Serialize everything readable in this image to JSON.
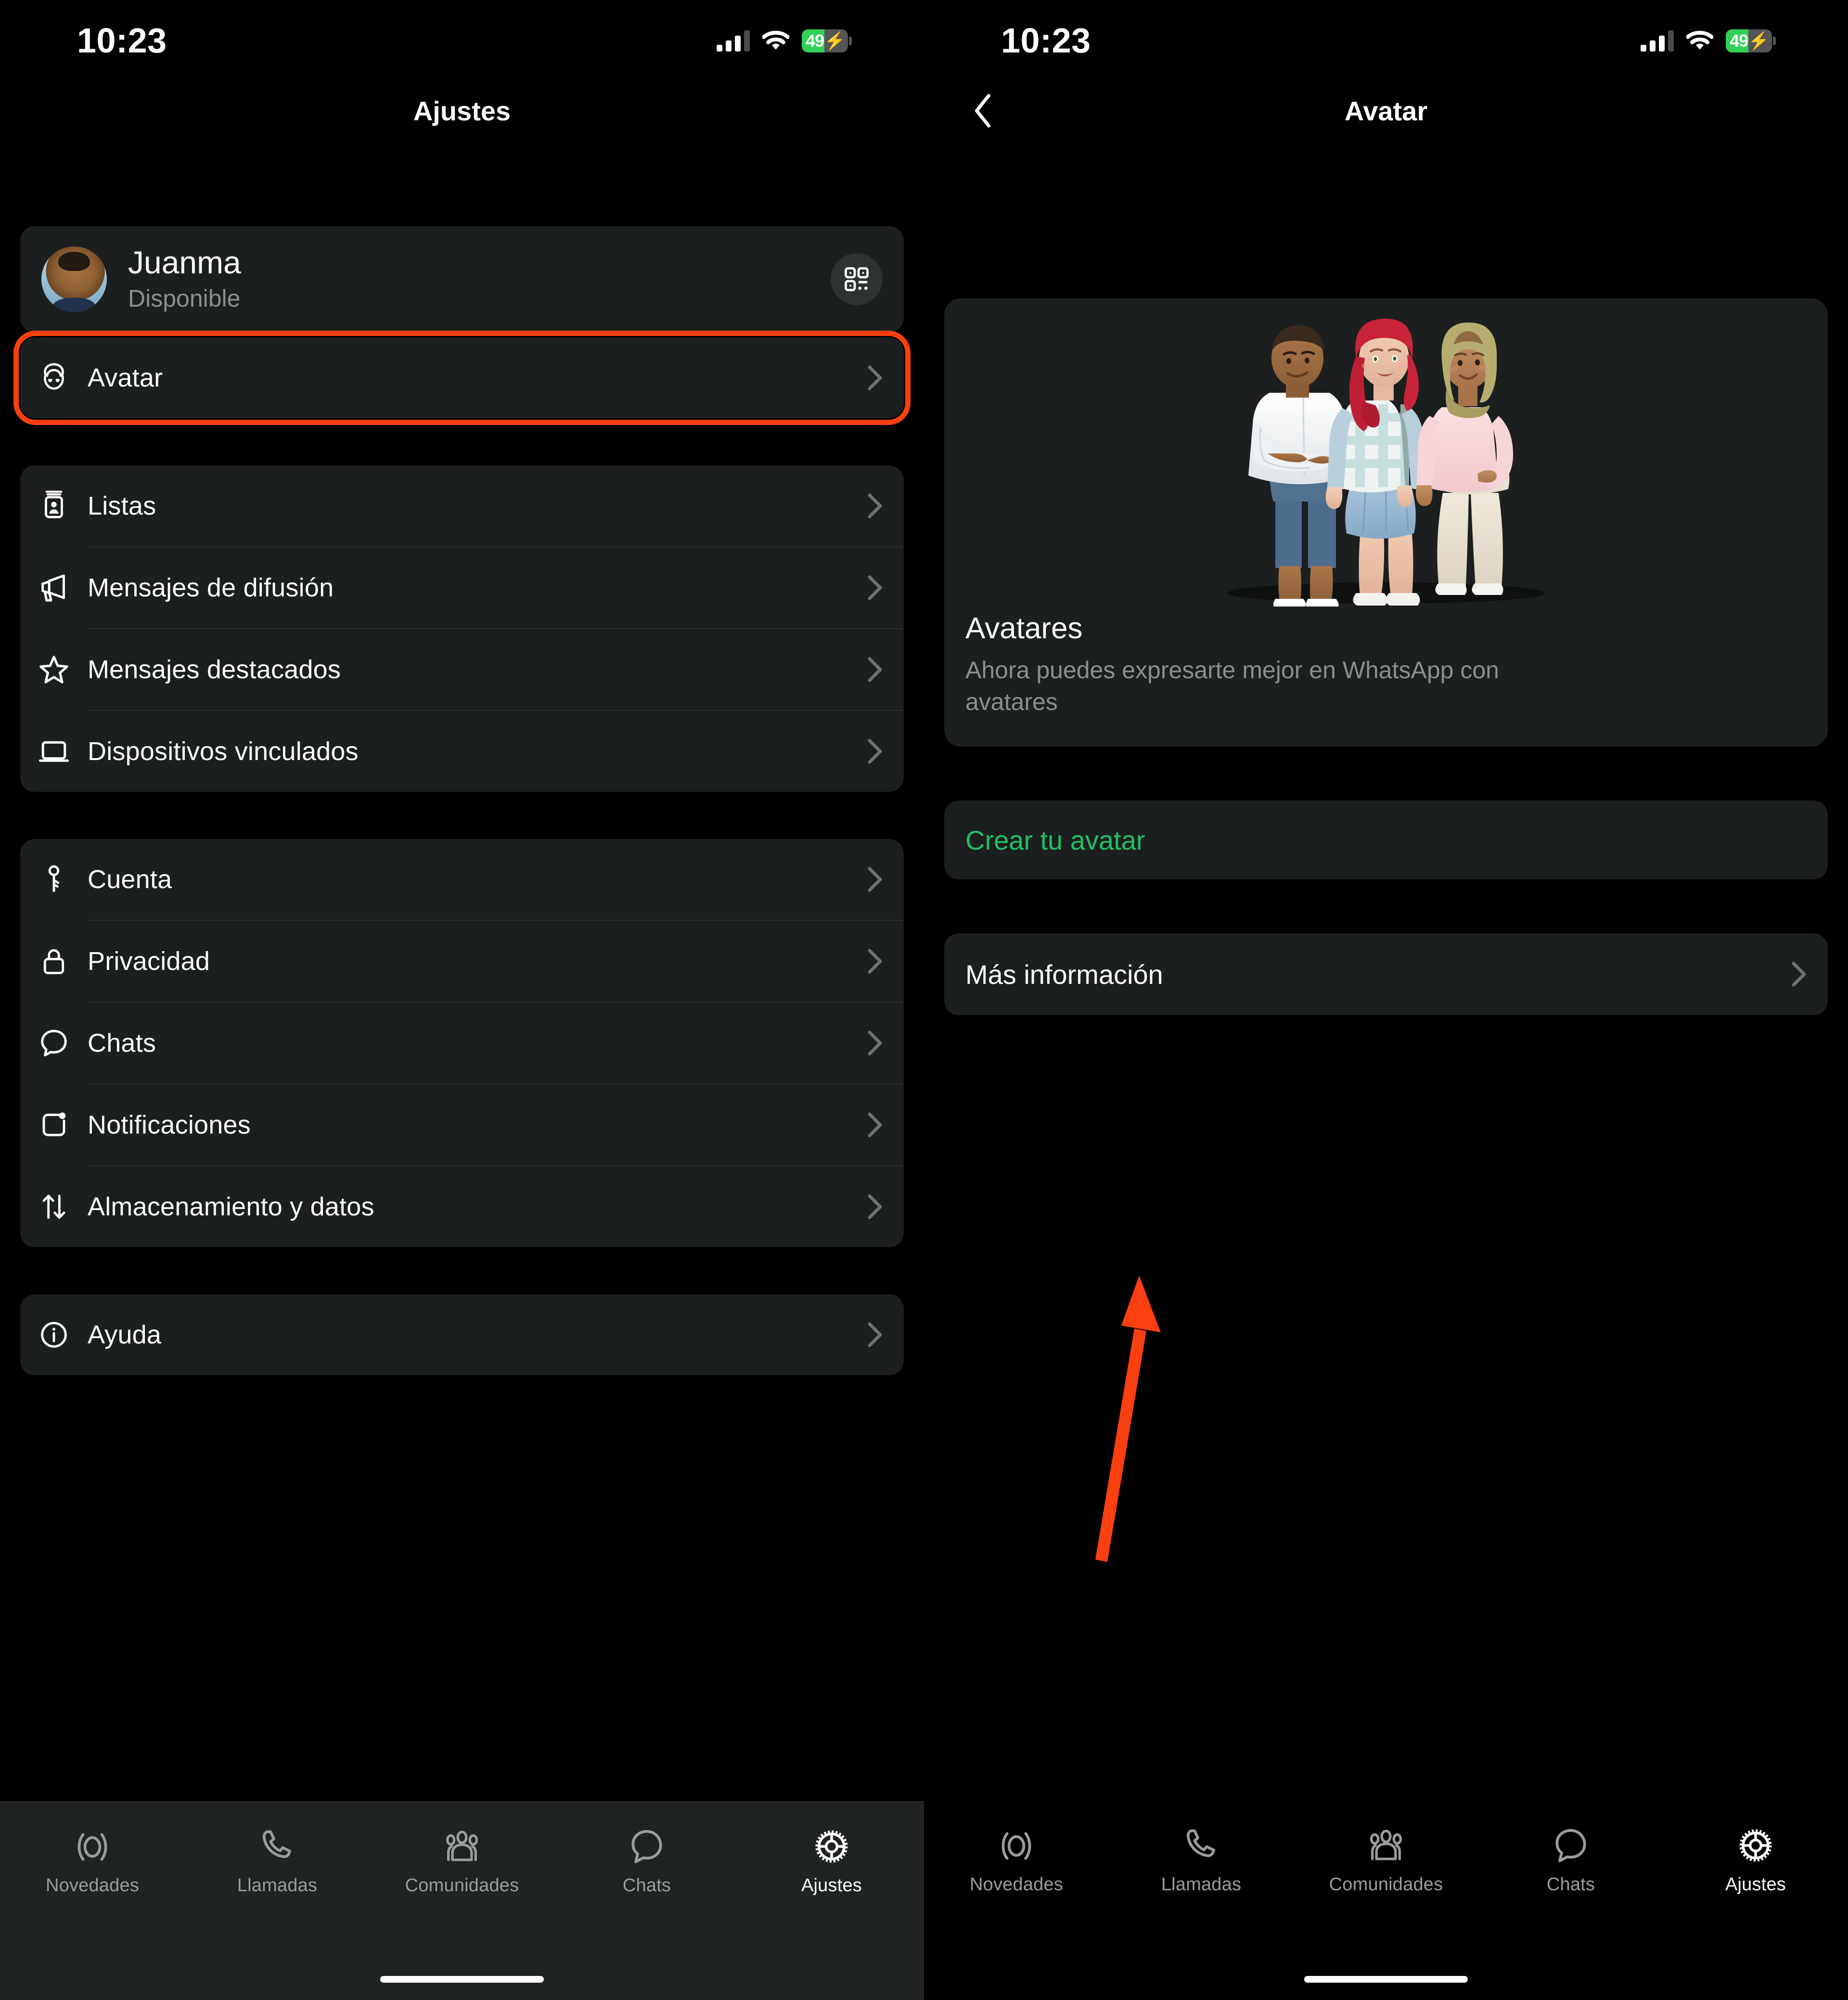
{
  "status_bar": {
    "time": "10:23",
    "battery_percent": "49",
    "battery_charging": true,
    "signal_icon": "cellular-signal-icon",
    "wifi_icon": "wifi-icon"
  },
  "left_screen": {
    "nav": {
      "title": "Ajustes"
    },
    "profile": {
      "name": "Juanma",
      "status": "Disponible",
      "qr_icon": "qr-code-icon",
      "avatar_icon": "profile-photo"
    },
    "avatar_row": {
      "label": "Avatar",
      "icon": "avatar-face-icon",
      "chevron": "chevron-right-icon",
      "highlighted": true,
      "highlight_color": "#fa3f11"
    },
    "group_one": [
      {
        "label": "Listas",
        "icon": "contact-card-icon"
      },
      {
        "label": "Mensajes de difusión",
        "icon": "megaphone-icon"
      },
      {
        "label": "Mensajes destacados",
        "icon": "star-icon"
      },
      {
        "label": "Dispositivos vinculados",
        "icon": "laptop-icon"
      }
    ],
    "group_two": [
      {
        "label": "Cuenta",
        "icon": "key-icon"
      },
      {
        "label": "Privacidad",
        "icon": "lock-icon"
      },
      {
        "label": "Chats",
        "icon": "chat-bubble-icon"
      },
      {
        "label": "Notificaciones",
        "icon": "notification-bell-icon"
      },
      {
        "label": "Almacenamiento y datos",
        "icon": "arrows-updown-icon"
      }
    ],
    "group_three": [
      {
        "label": "Ayuda",
        "icon": "info-circle-icon"
      }
    ],
    "tabs": [
      {
        "label": "Novedades",
        "icon": "status-rings-icon",
        "active": false
      },
      {
        "label": "Llamadas",
        "icon": "phone-icon",
        "active": false
      },
      {
        "label": "Comunidades",
        "icon": "communities-icon",
        "active": false
      },
      {
        "label": "Chats",
        "icon": "chat-bubble-icon",
        "active": false
      },
      {
        "label": "Ajustes",
        "icon": "gear-icon",
        "active": true
      }
    ]
  },
  "right_screen": {
    "nav": {
      "title": "Avatar",
      "back_icon": "chevron-left-icon"
    },
    "hero": {
      "illustration": "three-3d-avatars-illustration",
      "title": "Avatares",
      "subtitle": "Ahora puedes expresarte mejor en WhatsApp con avatares"
    },
    "create_button": {
      "label": "Crear tu avatar",
      "color": "#21c063"
    },
    "more_info": {
      "label": "Más información",
      "chevron": "chevron-right-icon"
    },
    "annotation": {
      "type": "arrow",
      "color": "#fa3f11",
      "points_to": "Crear tu avatar"
    },
    "tabs": [
      {
        "label": "Novedades",
        "icon": "status-rings-icon",
        "active": false
      },
      {
        "label": "Llamadas",
        "icon": "phone-icon",
        "active": false
      },
      {
        "label": "Comunidades",
        "icon": "communities-icon",
        "active": false
      },
      {
        "label": "Chats",
        "icon": "chat-bubble-icon",
        "active": false
      },
      {
        "label": "Ajustes",
        "icon": "gear-icon",
        "active": true
      }
    ]
  }
}
